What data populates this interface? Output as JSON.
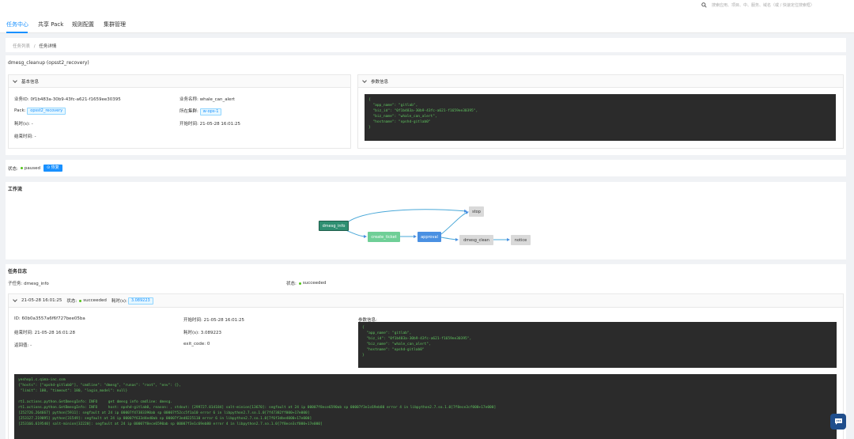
{
  "search": {
    "placeholder": "搜索应用、项目、中、服务、域名（或 / 快速定位搜索框）"
  },
  "nav": {
    "items": [
      "任务中心",
      "共享 Pack",
      "规则配置",
      "集群管理"
    ]
  },
  "breadcrumb": {
    "list": "任务列表",
    "sep": "/",
    "current": "任务详情"
  },
  "task": {
    "title": "dmesg_cleanup (opsst2_recovery)"
  },
  "basic": {
    "header": "基本信息",
    "biz_id_label": "业务ID:",
    "biz_id": "0f1b483a-30b9-43fc-a621-f1659ee30395",
    "biz_name_label": "业务名称:",
    "biz_name": "whale_can_alert",
    "pack_label": "Pack:",
    "pack": "opsst2_recovery",
    "cluster_label": "所在集群:",
    "cluster": "w-ops-1",
    "duration_label": "耗时(s):",
    "duration": "-",
    "start_label": "开始时间:",
    "start": "21-05-28 16:01:25",
    "end_label": "结束时间:",
    "end": "-"
  },
  "params": {
    "header": "参数信息",
    "code": "{\n  \"app_name\": \"gitlab\",\n  \"biz_id\": \"0f1b483a-30b9-43fc-a621-f1659ee30395\",\n  \"biz_name\": \"whale_can_alert\",\n  \"hostname\": \"opshd-gitlab0\"\n}"
  },
  "status": {
    "label": "状态:",
    "value": "paused",
    "resume": "恢复"
  },
  "workflow": {
    "title": "工作流",
    "nodes": [
      "dmesg_info",
      "create_ticket",
      "approval",
      "stop",
      "dmesg_clean",
      "notice"
    ]
  },
  "log": {
    "title": "任务日志",
    "subtask_label": "子任务:",
    "subtask": "dmesg_info",
    "status_label": "状态:",
    "status": "succeeded",
    "run": {
      "time": "21-05-28 16:01:25",
      "status_label": "状态:",
      "status": "succeeded",
      "duration_label": "耗时(s):",
      "duration": "3.089223",
      "id_label": "ID:",
      "id": "60b0a3557a6f6f727bee05ba",
      "start_label": "开始时间:",
      "start": "21-05-28 16:01:25",
      "end_label": "结束时间:",
      "end": "21-05-28 16:01:28",
      "dur_label": "耗时(s):",
      "dur": "3.089223",
      "ret_label": "返回值:",
      "ret": "-",
      "exit_label": "exit_code:",
      "exit": "0",
      "params_label": "参数信息:",
      "params_code": "{\n  \"app_name\": \"gitlab\",\n  \"biz_id\": \"0f1b483a-30b9-43fc-a621-f1659ee30395\",\n  \"biz_name\": \"whale_can_alert\",\n  \"hostname\": \"opshd-gitlab0\"\n}",
      "output": "yeshop1.c.qima-inc.com\n{\"hosts\": [\"opshd-gitlab0\"], \"cmdline\": \"dmesg\", \"runas\": \"root\", \"env\": {},\n \"limit\": 100, \"timeout\": 180, \"login_model\": null}\n\nrt1.actions.python.GetDmesgInfo: INFO     get dmesg info cmdline: dmesg.\nrt1.actions.python.GetDmesgInfo: INFO     host: opshd-gitlab0, reason: , stdout: [299727.814184] salt-minion[13670]: segfault at 24 ip 00007f8ece6590ab sp 00007f3e1c69eb80 error 4 in libpython2.7.so.1.0[7f8ece3cf000+17e000]\n[252726.264667] python[5911]: segfault at 24 ip 00007f47383390ab sp 00007f52cc5f1a10 error 6 in libpython2.7.so.1.0[7f47382ff000+17e000]\n[253127.219095] python[31549]: segfault at 24 ip 00007f633d4ed0ab sp 00007f3ed8225110 error 6 in libpython2.7.so.1.0[7f6f3dbe4000+17e000]\n[253166.619540] salt-minion[32220]: segfault at 24 ip 00007f8ece6590ab sp 00007f3e1c69eb80 error 4 in libpython2.7.so.1.0[7f8ece3cf000+17e000]"
    }
  },
  "colors": {
    "accent": "#1890ff",
    "success": "#52c41a",
    "code_bg": "#2b2b2b",
    "code_fg": "#5fc35f",
    "node_active": "#2f8f72",
    "node_green": "#6fcf97",
    "node_blue": "#4a90e2",
    "node_gray": "#d9d9d9"
  },
  "icons": {
    "search": "search-icon",
    "chat": "chat-bubble-icon",
    "expand": "chevron-down-icon",
    "resume": "play-circle-icon"
  }
}
